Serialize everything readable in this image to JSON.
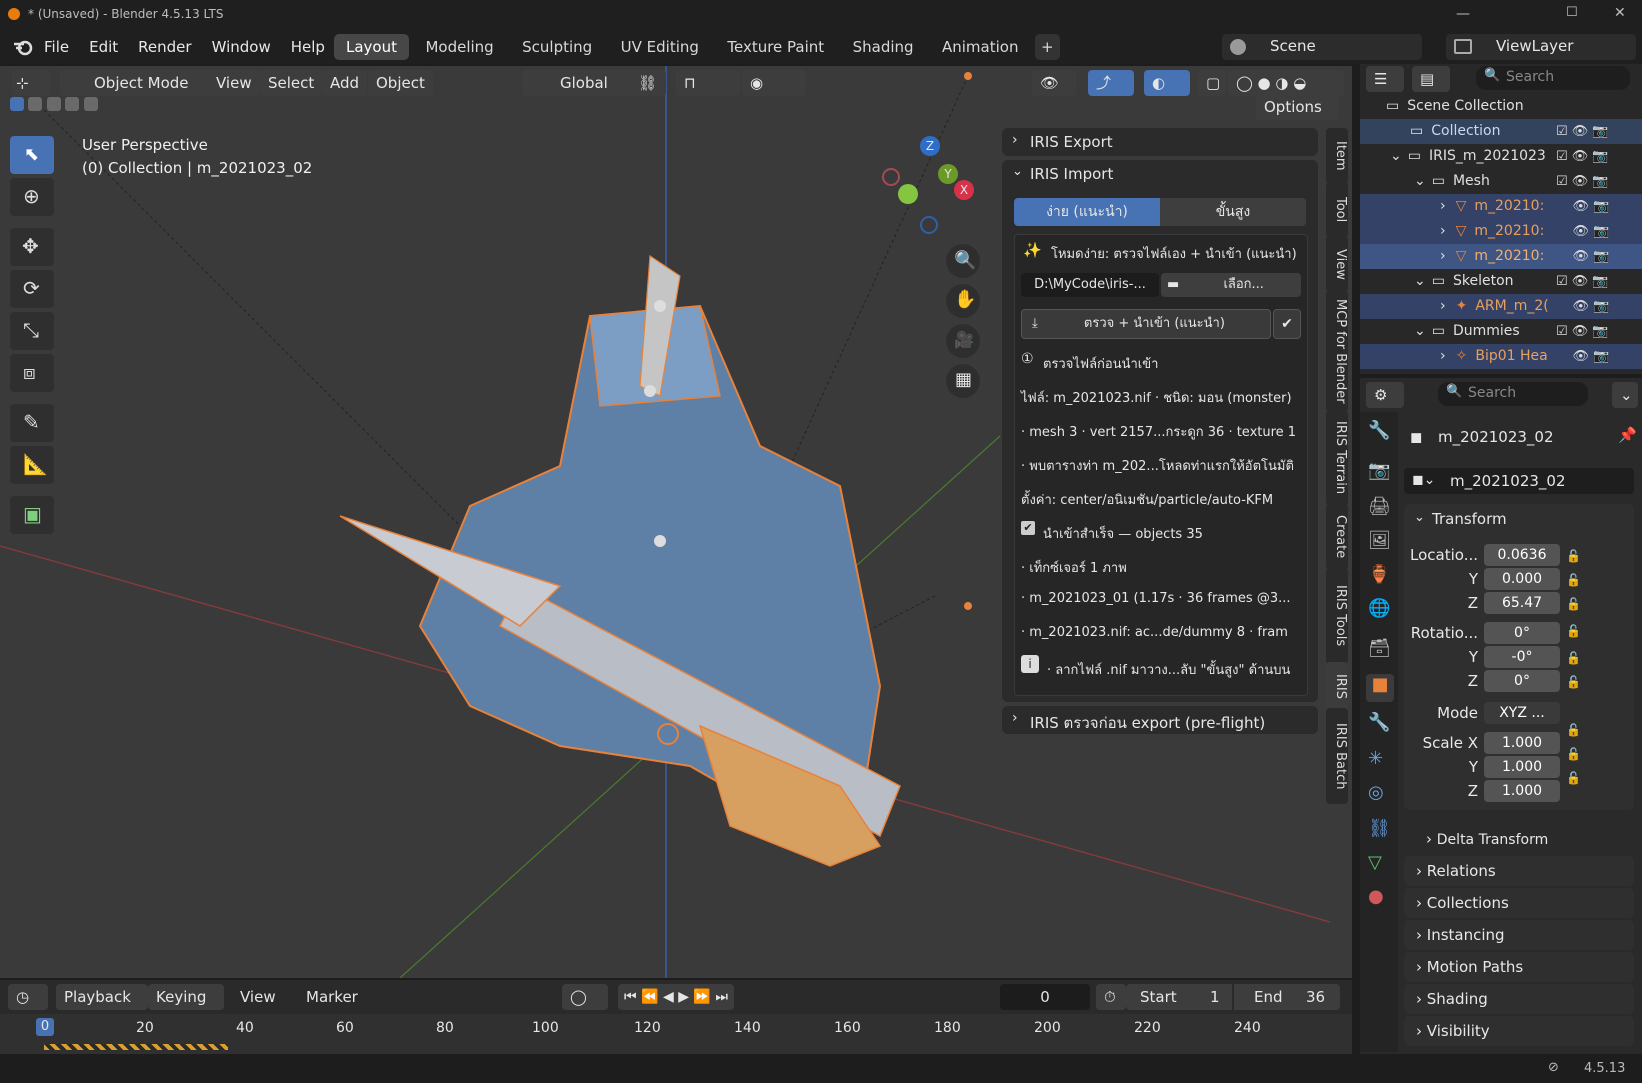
{
  "window": {
    "title": "* (Unsaved) - Blender 4.5.13 LTS",
    "min": "—",
    "max": "☐",
    "close": "✕"
  },
  "menu": {
    "items": [
      "File",
      "Edit",
      "Render",
      "Window",
      "Help"
    ]
  },
  "workspaces": {
    "tabs": [
      "Layout",
      "Modeling",
      "Sculpting",
      "UV Editing",
      "Texture Paint",
      "Shading",
      "Animation"
    ],
    "active": "Layout",
    "add": "+"
  },
  "scene": {
    "name": "Scene",
    "viewlayer": "ViewLayer"
  },
  "header": {
    "mode": "Object Mode",
    "view": "View",
    "select": "Select",
    "add": "Add",
    "object": "Object",
    "orientation": "Global",
    "options": "Options"
  },
  "viewport": {
    "perspective": "User Perspective",
    "collection": "(0) Collection | m_2021023_02"
  },
  "gizmo": {
    "z": "Z",
    "y": "Y",
    "x": "X"
  },
  "sidebar": {
    "tabs": [
      "Item",
      "Tool",
      "View",
      "MCP for Blender",
      "IRIS Terrain",
      "Create",
      "IRIS Tools",
      "IRIS",
      "IRIS Batch"
    ],
    "export_title": "IRIS Export",
    "import_title": "IRIS Import",
    "mode_easy": "ง่าย (แนะนำ)",
    "mode_adv": "ขั้นสูง",
    "easy_desc": "โหมดง่าย: ตรวจไฟล์เอง + นำเข้า (แนะนำ)",
    "path": "D:\\MyCode\\iris-...",
    "browse": "เลือก...",
    "check_import": "ตรวจ + นำเข้า (แนะนำ)",
    "lines": [
      "ตรวจไฟล์ก่อนนำเข้า",
      "ไฟล์: m_2021023.nif · ชนิด: มอน (monster)",
      "· mesh 3 · vert 2157...กระดูก 36 · texture 1",
      "· พบตารางท่า m_202...โหลดท่าแรกให้อัตโนมัติ",
      "ตั้งค่า: center/อนิเมชัน/particle/auto-KFM",
      "นำเข้าสำเร็จ — objects 35",
      "· เท็กซ์เจอร์ 1 ภาพ",
      "· m_2021023_01 (1.17s · 36 frames @3...",
      "· m_2021023.nif: ac...de/dummy 8 · fram",
      "· ลากไฟล์ .nif มาวาง...ลับ \"ขั้นสูง\" ด้านบน"
    ],
    "preflight_title": "IRIS ตรวจก่อน export (pre-flight)"
  },
  "outliner": {
    "search_placeholder": "Search",
    "rows": [
      {
        "label": "Scene Collection"
      },
      {
        "label": "Collection"
      },
      {
        "label": "IRIS_m_2021023"
      },
      {
        "label": "Mesh"
      },
      {
        "label": "m_20210:"
      },
      {
        "label": "m_20210:"
      },
      {
        "label": "m_20210:"
      },
      {
        "label": "Skeleton"
      },
      {
        "label": "ARM_m_2("
      },
      {
        "label": "Dummies"
      },
      {
        "label": "Bip01 Hea"
      }
    ]
  },
  "properties": {
    "search_placeholder": "Search",
    "object_name": "m_2021023_02",
    "data_name": "m_2021023_02",
    "transform_title": "Transform",
    "location_label": "Locatio...",
    "loc": [
      "0.0636",
      "0.000",
      "65.47"
    ],
    "rotation_label": "Rotatio...",
    "rot": [
      "0°",
      "-0°",
      "0°"
    ],
    "mode_label": "Mode",
    "mode_value": "XYZ ...",
    "scale_label": "Scale X",
    "scale": [
      "1.000",
      "1.000",
      "1.000"
    ],
    "axis_y": "Y",
    "axis_z": "Z",
    "delta": "Delta Transform",
    "sections": [
      "Relations",
      "Collections",
      "Instancing",
      "Motion Paths",
      "Shading",
      "Visibility"
    ]
  },
  "timeline": {
    "playback": "Playback",
    "keying": "Keying",
    "view": "View",
    "marker": "Marker",
    "current": "0",
    "start_label": "Start",
    "start": "1",
    "end_label": "End",
    "end": "36",
    "ticks": [
      "0",
      "20",
      "40",
      "60",
      "80",
      "100",
      "120",
      "140",
      "160",
      "180",
      "200",
      "220",
      "240"
    ]
  },
  "status": {
    "version": "4.5.13"
  }
}
